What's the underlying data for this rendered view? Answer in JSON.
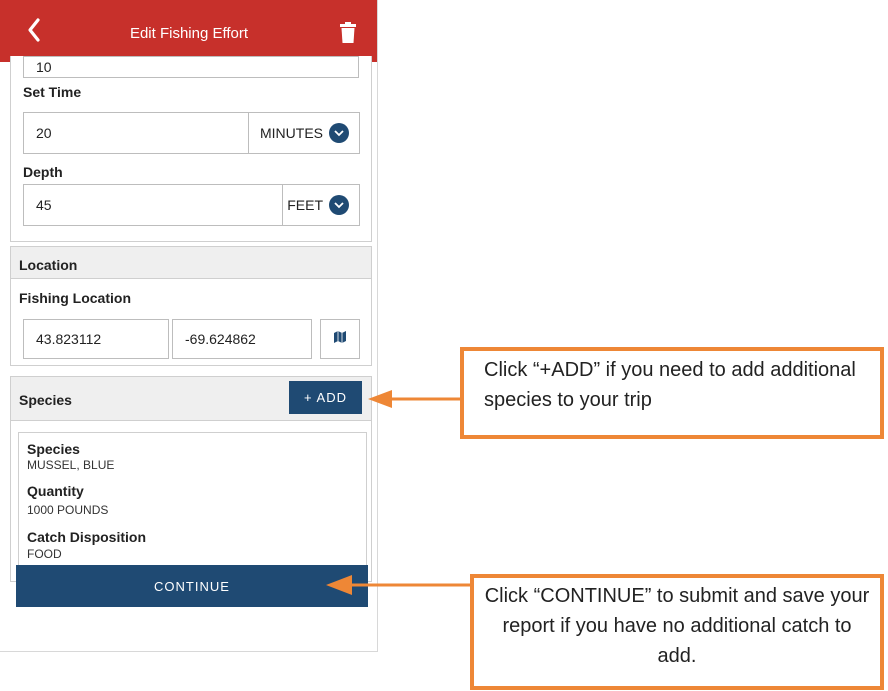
{
  "header": {
    "title": "Edit Fishing Effort",
    "back_icon": "chevron-left-icon",
    "delete_icon": "trash-icon"
  },
  "effort": {
    "prev_value": "10",
    "set_time": {
      "label": "Set Time",
      "value": "20",
      "unit": "MINUTES"
    },
    "depth": {
      "label": "Depth",
      "value": "45",
      "unit": "FEET"
    }
  },
  "location": {
    "heading": "Location",
    "label": "Fishing Location",
    "latitude": "43.823112",
    "longitude": "-69.624862",
    "map_icon": "map-icon"
  },
  "species": {
    "heading": "Species",
    "add_label": "+ ADD",
    "card": {
      "species_label": "Species",
      "species_value": "MUSSEL, BLUE",
      "quantity_label": "Quantity",
      "quantity_value": "1000 POUNDS",
      "disposition_label": "Catch Disposition",
      "disposition_value": "FOOD"
    }
  },
  "continue_label": "CONTINUE",
  "callouts": {
    "add": "Click “+ADD” if you need to add additional species to your trip",
    "continue": "Click “CONTINUE” to submit and save your report if you have no additional catch to add."
  },
  "colors": {
    "header": "#c7302b",
    "button": "#1f4a73",
    "callout_border": "#ee8736"
  }
}
